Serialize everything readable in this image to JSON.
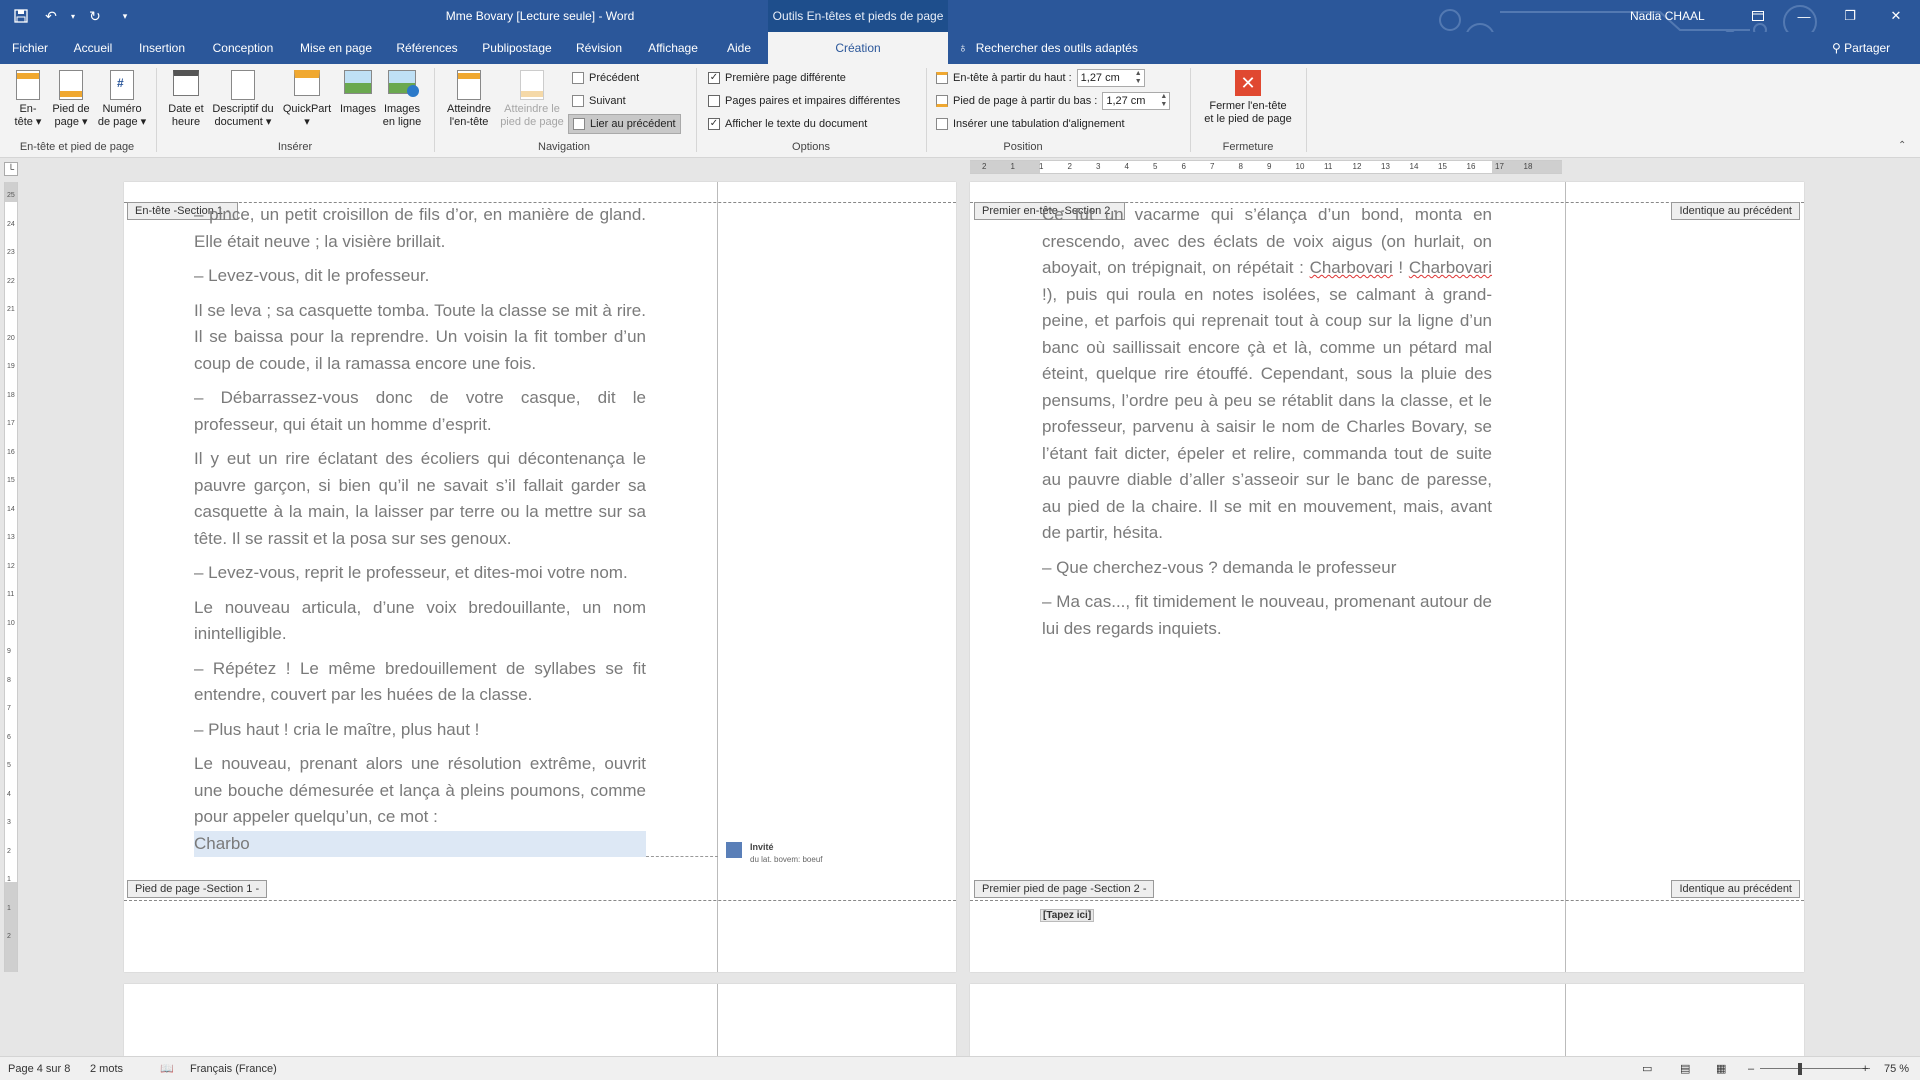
{
  "app": {
    "doc_title": "Mme Bovary [Lecture seule] - Word",
    "context_tab_title": "Outils En-têtes et pieds de page",
    "user_name": "Nadia CHAAL",
    "window_controls": [
      "—",
      "❐",
      "✕"
    ],
    "share_label": "Partager",
    "tell_me": "Rechercher des outils adaptés",
    "theme_color": "#2b579a"
  },
  "tabs": [
    {
      "label": "Fichier"
    },
    {
      "label": "Accueil"
    },
    {
      "label": "Insertion"
    },
    {
      "label": "Conception"
    },
    {
      "label": "Mise en page"
    },
    {
      "label": "Références"
    },
    {
      "label": "Publipostage"
    },
    {
      "label": "Révision"
    },
    {
      "label": "Affichage"
    },
    {
      "label": "Aide"
    },
    {
      "label": "Création"
    }
  ],
  "ribbon": {
    "groups": {
      "header_footer": "En-tête et pied de page",
      "insert": "Insérer",
      "navigation": "Navigation",
      "options": "Options",
      "position": "Position",
      "close": "Fermeture"
    },
    "header_btn": [
      "En-",
      "tête ▾"
    ],
    "footer_btn": [
      "Pied de",
      "page ▾"
    ],
    "pagenum_btn": [
      "Numéro",
      "de page ▾"
    ],
    "datetime_btn": [
      "Date et",
      "heure"
    ],
    "docinfo_btn": [
      "Descriptif du",
      "document ▾"
    ],
    "quickpart_btn": [
      "QuickPart",
      "▾"
    ],
    "images_btn": [
      "Images",
      ""
    ],
    "online_images_btn": [
      "Images",
      "en ligne"
    ],
    "goto_header_btn": [
      "Atteindre",
      "l'en-tête"
    ],
    "goto_footer_btn": [
      "Atteindre le",
      "pied de page"
    ],
    "previous": "Précédent",
    "next": "Suivant",
    "link_previous": "Lier au précédent",
    "opt_first_page": "Première page différente",
    "opt_odd_even": "Pages paires et impaires différentes",
    "opt_show_text": "Afficher le texte du document",
    "opt_first_page_checked": true,
    "opt_odd_even_checked": false,
    "opt_show_text_checked": true,
    "header_from_top_label": "En-tête à partir du haut :",
    "header_from_top_value": "1,27 cm",
    "footer_from_bottom_label": "Pied de page à partir du bas :",
    "footer_from_bottom_value": "1,27 cm",
    "insert_tab_alignment": "Insérer une tabulation d'alignement",
    "close_btn": [
      "Fermer l'en-tête",
      "et le pied de page"
    ]
  },
  "ruler": {
    "ticks": [
      "2",
      "1",
      "1",
      "2",
      "3",
      "4",
      "5",
      "6",
      "7",
      "8",
      "9",
      "10",
      "11",
      "12",
      "13",
      "14",
      "15",
      "16",
      "17",
      "18"
    ],
    "vticks": [
      "25",
      "24",
      "23",
      "22",
      "21",
      "20",
      "19",
      "18",
      "17",
      "16",
      "15",
      "14",
      "13",
      "12",
      "11",
      "10",
      "9",
      "8",
      "7",
      "6",
      "5",
      "4",
      "3",
      "2",
      "1",
      "1",
      "2"
    ]
  },
  "page_left": {
    "header_tag": "En-tête -Section 1 -",
    "footer_tag": "Pied de page -Section 1 -",
    "paragraphs": [
      "– pince, un petit croisillon de fils d’or, en manière de gland. Elle était neuve ; la visière brillait.",
      "– Levez-vous, dit le professeur.",
      "Il se leva ; sa casquette tomba. Toute la classe se mit à rire. Il se baissa pour la reprendre. Un voisin la fit tomber d’un coup de coude, il la ramassa encore une fois.",
      "– Débarrassez-vous donc de votre casque, dit le professeur, qui était un homme d’esprit.",
      "Il y eut un rire éclatant des écoliers qui décontenança le pauvre garçon, si bien qu’il ne savait s’il fallait garder sa casquette à la main, la laisser par terre ou la mettre sur sa tête. Il se rassit et la posa sur ses genoux.",
      " – Levez-vous, reprit le professeur, et dites-moi votre nom.",
      "Le nouveau articula, d’une voix bredouillante, un nom inintelligible.",
      " – Répétez ! Le même bredouillement de syllabes se fit entendre, couvert par les huées de la classe.",
      "– Plus haut ! cria le maître, plus haut !"
    ],
    "last_paragraph": "Le nouveau, prenant alors une résolution extrême, ouvrit une bouche démesurée et lança à pleins poumons, comme pour appeler quelqu’un, ce mot :",
    "last_word": "Charbo",
    "comment_author": "Invité",
    "comment_text": "du lat. bovem: boeuf"
  },
  "page_right": {
    "header_tag": "Premier en-tête -Section 2 -",
    "header_same_as_prev": "Identique au précédent",
    "footer_tag": "Premier pied de page -Section 2 -",
    "footer_same_as_prev": "Identique au précédent",
    "footer_placeholder": "[Tapez ici]",
    "p1_start": "Ce fut un vacarme qui s’élança d’un bond, monta en crescendo, avec des éclats de voix aigus (on hurlait, on aboyait, on trépignait, on répétait : ",
    "p1_word1": "Charbovari",
    "p1_mid": " ! ",
    "p1_word2": "Charbovari",
    "p1_end": " !), puis qui roula en notes isolées, se calmant à grand-peine, et parfois qui reprenait tout à coup sur la ligne d’un banc où saillissait encore çà et là, comme un pétard mal éteint, quelque rire étouffé. Cependant, sous la pluie des pensums, l’ordre peu à peu se rétablit dans la classe, et le professeur, parvenu à saisir le nom de Charles Bovary, se l’étant fait dicter, épeler et relire, commanda tout de suite au pauvre diable d’aller s’asseoir sur le banc de paresse, au pied de la chaire. Il se mit en mouvement, mais, avant de partir, hésita.",
    "p2": "– Que cherchez-vous ? demanda le professeur",
    "p3": "– Ma cas..., fit timidement le nouveau, promenant autour de lui des regards inquiets."
  },
  "status": {
    "page": "Page 4 sur 8",
    "words": "2 mots",
    "language": "Français (France)",
    "zoom": "75 %",
    "zoom_minus": "–",
    "zoom_plus": "+",
    "zoom_level": 0.75
  }
}
